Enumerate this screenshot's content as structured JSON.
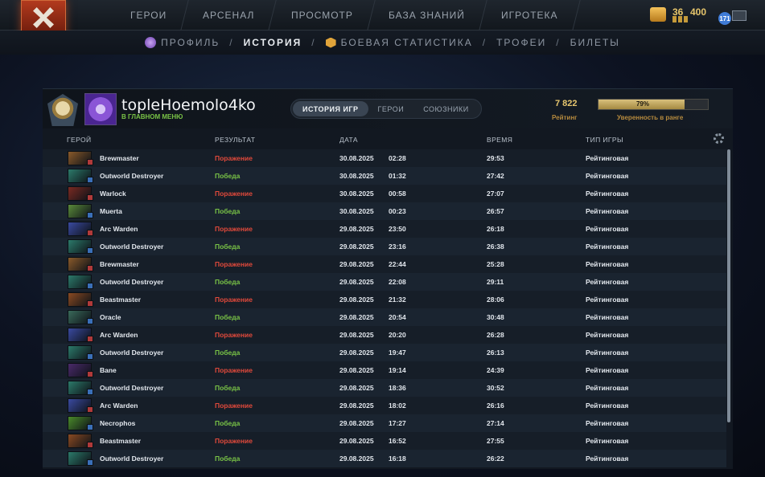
{
  "nav": {
    "items": [
      "ГЕРОИ",
      "АРСЕНАЛ",
      "ПРОСМОТР",
      "БАЗА ЗНАНИЙ",
      "ИГРОТЕКА"
    ]
  },
  "resources": {
    "shards": "36",
    "points": "400",
    "notifications": "171"
  },
  "subnav": {
    "profile": "ПРОФИЛЬ",
    "history": "ИСТОРИЯ",
    "combat": "БОЕВАЯ СТАТИСТИКА",
    "trophies": "ТРОФЕИ",
    "tickets": "БИЛЕТЫ",
    "sep": "/"
  },
  "player": {
    "name": "topleHoemolo4ko",
    "status": "В ГЛАВНОМ МЕНЮ"
  },
  "tabs": [
    "ИСТОРИЯ ИГР",
    "ГЕРОИ",
    "СОЮЗНИКИ"
  ],
  "rating": {
    "value": "7 822",
    "label": "Рейтинг"
  },
  "confidence": {
    "value": "79%",
    "fraction": 0.79,
    "label": "Уверенность в ранге"
  },
  "columns": {
    "hero": "ГЕРОЙ",
    "result": "РЕЗУЛЬТАТ",
    "date": "ДАТА",
    "duration": "ВРЕМЯ",
    "mode": "ТИП ИГРЫ"
  },
  "matches": [
    {
      "hero": "Brewmaster",
      "result": "Поражение",
      "win": false,
      "date": "30.08.2025",
      "time": "02:28",
      "duration": "29:53",
      "mode": "Рейтинговая",
      "color": "#8a5a2a"
    },
    {
      "hero": "Outworld Destroyer",
      "result": "Победа",
      "win": true,
      "date": "30.08.2025",
      "time": "01:32",
      "duration": "27:42",
      "mode": "Рейтинговая",
      "color": "#2c7a6a"
    },
    {
      "hero": "Warlock",
      "result": "Поражение",
      "win": false,
      "date": "30.08.2025",
      "time": "00:58",
      "duration": "27:07",
      "mode": "Рейтинговая",
      "color": "#7a2a22"
    },
    {
      "hero": "Muerta",
      "result": "Победа",
      "win": true,
      "date": "30.08.2025",
      "time": "00:23",
      "duration": "26:57",
      "mode": "Рейтинговая",
      "color": "#5a8a3a"
    },
    {
      "hero": "Arc Warden",
      "result": "Поражение",
      "win": false,
      "date": "29.08.2025",
      "time": "23:50",
      "duration": "26:18",
      "mode": "Рейтинговая",
      "color": "#3a4aa0"
    },
    {
      "hero": "Outworld Destroyer",
      "result": "Победа",
      "win": true,
      "date": "29.08.2025",
      "time": "23:16",
      "duration": "26:38",
      "mode": "Рейтинговая",
      "color": "#2c7a6a"
    },
    {
      "hero": "Brewmaster",
      "result": "Поражение",
      "win": false,
      "date": "29.08.2025",
      "time": "22:44",
      "duration": "25:28",
      "mode": "Рейтинговая",
      "color": "#8a5a2a"
    },
    {
      "hero": "Outworld Destroyer",
      "result": "Победа",
      "win": true,
      "date": "29.08.2025",
      "time": "22:08",
      "duration": "29:11",
      "mode": "Рейтинговая",
      "color": "#2c7a6a"
    },
    {
      "hero": "Beastmaster",
      "result": "Поражение",
      "win": false,
      "date": "29.08.2025",
      "time": "21:32",
      "duration": "28:06",
      "mode": "Рейтинговая",
      "color": "#8a4a22"
    },
    {
      "hero": "Oracle",
      "result": "Победа",
      "win": true,
      "date": "29.08.2025",
      "time": "20:54",
      "duration": "30:48",
      "mode": "Рейтинговая",
      "color": "#3a6a5a"
    },
    {
      "hero": "Arc Warden",
      "result": "Поражение",
      "win": false,
      "date": "29.08.2025",
      "time": "20:20",
      "duration": "26:28",
      "mode": "Рейтинговая",
      "color": "#3a4aa0"
    },
    {
      "hero": "Outworld Destroyer",
      "result": "Победа",
      "win": true,
      "date": "29.08.2025",
      "time": "19:47",
      "duration": "26:13",
      "mode": "Рейтинговая",
      "color": "#2c7a6a"
    },
    {
      "hero": "Bane",
      "result": "Поражение",
      "win": false,
      "date": "29.08.2025",
      "time": "19:14",
      "duration": "24:39",
      "mode": "Рейтинговая",
      "color": "#4a2a6a"
    },
    {
      "hero": "Outworld Destroyer",
      "result": "Победа",
      "win": true,
      "date": "29.08.2025",
      "time": "18:36",
      "duration": "30:52",
      "mode": "Рейтинговая",
      "color": "#2c7a6a"
    },
    {
      "hero": "Arc Warden",
      "result": "Поражение",
      "win": false,
      "date": "29.08.2025",
      "time": "18:02",
      "duration": "26:16",
      "mode": "Рейтинговая",
      "color": "#3a4aa0"
    },
    {
      "hero": "Necrophos",
      "result": "Победа",
      "win": true,
      "date": "29.08.2025",
      "time": "17:27",
      "duration": "27:14",
      "mode": "Рейтинговая",
      "color": "#4a8a2a"
    },
    {
      "hero": "Beastmaster",
      "result": "Поражение",
      "win": false,
      "date": "29.08.2025",
      "time": "16:52",
      "duration": "27:55",
      "mode": "Рейтинговая",
      "color": "#8a4a22"
    },
    {
      "hero": "Outworld Destroyer",
      "result": "Победа",
      "win": true,
      "date": "29.08.2025",
      "time": "16:18",
      "duration": "26:22",
      "mode": "Рейтинговая",
      "color": "#2c7a6a"
    }
  ],
  "colors": {
    "win": "#79c346",
    "loss": "#e0493b",
    "gold": "#e7c66f"
  }
}
